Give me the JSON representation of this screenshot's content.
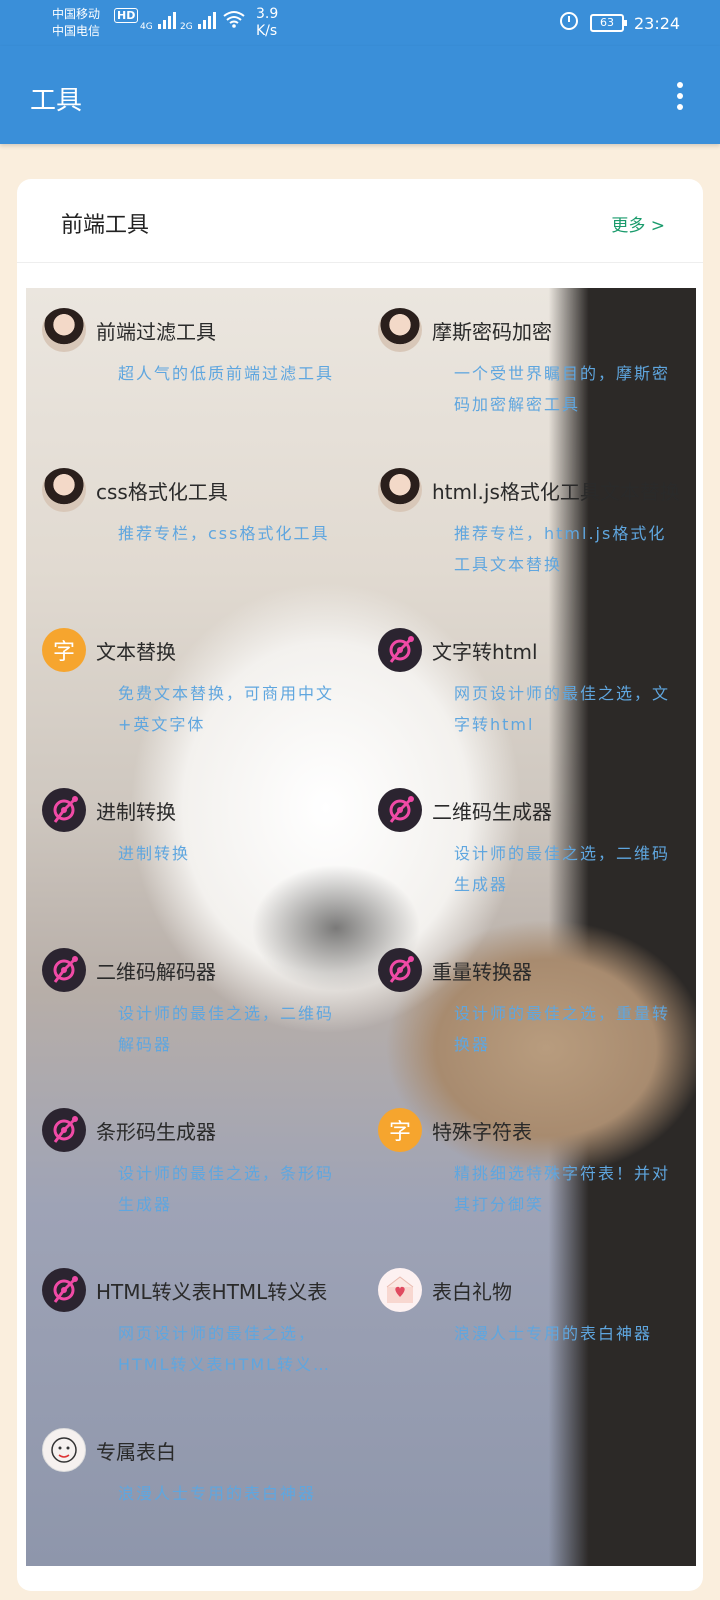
{
  "status_bar": {
    "carrier_1": "中国移动",
    "carrier_2": "中国电信",
    "hd_label": "HD",
    "network_1": "4G",
    "network_2": "2G",
    "speed_value": "3.9",
    "speed_unit": "K/s",
    "battery": "63",
    "time": "23:24"
  },
  "app_bar": {
    "title": "工具"
  },
  "card": {
    "title": "前端工具",
    "more_label": "更多 >"
  },
  "tools": [
    {
      "title": "前端过滤工具",
      "desc": "超人气的低质前端过滤工具",
      "icon": "avatar-icon"
    },
    {
      "title": "摩斯密码加密",
      "desc": "一个受世界瞩目的，摩斯密码加密解密工具",
      "icon": "avatar-icon"
    },
    {
      "title": "css格式化工具",
      "desc": "推荐专栏，css格式化工具",
      "icon": "avatar-icon"
    },
    {
      "title": "html.js格式化工具文本替换",
      "desc": "推荐专栏，html.js格式化工具文本替换",
      "icon": "avatar-icon"
    },
    {
      "title": "文本替换",
      "desc": "免费文本替换，可商用中文+英文字体",
      "icon": "char-icon",
      "glyph": "字"
    },
    {
      "title": "文字转html",
      "desc": "网页设计师的最佳之选，文字转html",
      "icon": "target-icon"
    },
    {
      "title": "进制转换",
      "desc": "进制转换",
      "icon": "target-icon"
    },
    {
      "title": "二维码生成器",
      "desc": "设计师的最佳之选，二维码生成器",
      "icon": "target-icon"
    },
    {
      "title": "二维码解码器",
      "desc": "设计师的最佳之选，二维码解码器",
      "icon": "target-icon"
    },
    {
      "title": "重量转换器",
      "desc": "设计师的最佳之选，重量转换器",
      "icon": "target-icon"
    },
    {
      "title": "条形码生成器",
      "desc": "设计师的最佳之选，条形码生成器",
      "icon": "target-icon"
    },
    {
      "title": "特殊字符表",
      "desc": "精挑细选特殊字符表！并对其打分御笑",
      "icon": "char-icon",
      "glyph": "字"
    },
    {
      "title": "HTML转义表HTML转义表",
      "desc": "网页设计师的最佳之选，HTML转义表HTML转义…",
      "icon": "target-icon"
    },
    {
      "title": "表白礼物",
      "desc": "浪漫人士专用的表白神器",
      "icon": "gift-icon"
    },
    {
      "title": "专属表白",
      "desc": "浪漫人士专用的表白神器",
      "icon": "doodle-icon"
    }
  ]
}
